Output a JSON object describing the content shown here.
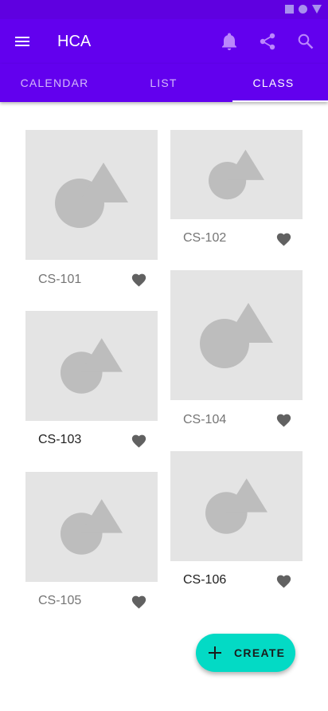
{
  "app": {
    "title": "HCA"
  },
  "tabs": [
    {
      "label": "CALENDAR",
      "active": false
    },
    {
      "label": "LIST",
      "active": false
    },
    {
      "label": "CLASS",
      "active": true
    }
  ],
  "classes": [
    {
      "code": "CS-101",
      "favorite_icon": "heart-icon"
    },
    {
      "code": "CS-102",
      "favorite_icon": "heart-icon"
    },
    {
      "code": "CS-103",
      "favorite_icon": "heart-icon"
    },
    {
      "code": "CS-104",
      "favorite_icon": "heart-icon"
    },
    {
      "code": "CS-105",
      "favorite_icon": "heart-icon"
    },
    {
      "code": "CS-106",
      "favorite_icon": "heart-icon"
    }
  ],
  "fab": {
    "label": "CREATE",
    "icon": "plus-icon"
  },
  "colors": {
    "primary": "#6200ee",
    "status_bar": "#5f00e0",
    "accent": "#03dac5",
    "placeholder": "#e4e4e4"
  }
}
